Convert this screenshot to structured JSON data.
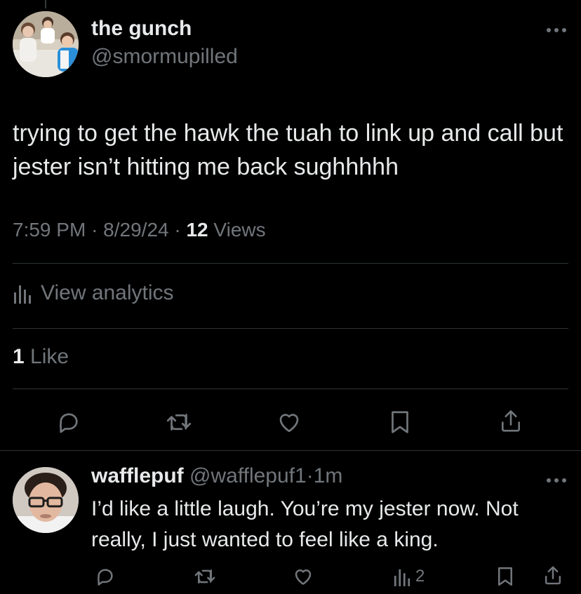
{
  "tweet": {
    "author_name": "the gunch",
    "author_handle": "@smormupilled",
    "text": "trying to get the hawk the tuah to link up and call but jester isn’t hitting me back sughhhhh",
    "time": "7:59 PM",
    "date": "8/29/24",
    "views_count": "12",
    "views_label": "Views",
    "analytics_label": "View analytics",
    "likes_count": "1",
    "likes_label": "Like",
    "separator": "·"
  },
  "reply": {
    "author_name": "wafflepuf",
    "author_handle": "@wafflepuf1",
    "age": "1m",
    "separator": "·",
    "text": "I’d like a little laugh. You’re my jester now. Not really, I just wanted to feel like a king.",
    "views_count": "2"
  },
  "icons": {
    "reply": "reply-bubble-icon",
    "retweet": "retweet-icon",
    "like": "heart-icon",
    "bookmark": "bookmark-icon",
    "share": "share-icon",
    "analytics": "bar-chart-icon",
    "more": "more-dots-icon"
  },
  "colors": {
    "background": "#000000",
    "primary_text": "#e7e9ea",
    "secondary_text": "#71767b",
    "divider": "#2f3336"
  }
}
